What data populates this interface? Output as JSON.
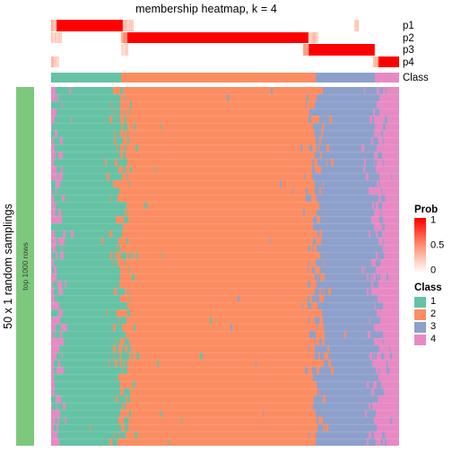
{
  "title": "membership heatmap, k = 4",
  "row_title": "50 x 1 random samplings",
  "row_group_label": "top 1000 rows",
  "annotation_rows": [
    {
      "label": "p1"
    },
    {
      "label": "p2"
    },
    {
      "label": "p3"
    },
    {
      "label": "p4"
    },
    {
      "label": "Class"
    }
  ],
  "legends": {
    "prob": {
      "title": "Prob",
      "ticks": [
        "1",
        "0.5",
        "0"
      ],
      "tick_values": [
        1,
        0.5,
        0
      ],
      "low_color": "#FFFFFF",
      "mid_color": "#FB9272",
      "high_color": "#FF0000"
    },
    "class": {
      "title": "Class",
      "items": [
        {
          "label": "1",
          "color": "#66C2A5"
        },
        {
          "label": "2",
          "color": "#FC8D62"
        },
        {
          "label": "3",
          "color": "#8DA0CB"
        },
        {
          "label": "4",
          "color": "#E78AC3"
        }
      ]
    }
  },
  "colors": {
    "class1": "#66C2A5",
    "class2": "#FC8D62",
    "class3": "#8DA0CB",
    "class4": "#E78AC3",
    "row_group_green": "#7DC87D",
    "background": "#FFFFFF"
  },
  "chart_data": {
    "type": "heatmap",
    "title": "membership heatmap, k = 4",
    "xlabel": "",
    "ylabel": "50 x 1 random samplings",
    "n_columns": 1000,
    "n_rows": 50,
    "legend_position": "right",
    "grid": false,
    "column_class_segments": [
      {
        "class": 4,
        "start": 0.0,
        "end": 0.013
      },
      {
        "class": 1,
        "start": 0.013,
        "end": 0.2
      },
      {
        "class": 2,
        "start": 0.2,
        "end": 0.76
      },
      {
        "class": 3,
        "start": 0.76,
        "end": 0.93
      },
      {
        "class": 4,
        "start": 0.93,
        "end": 1.0
      }
    ],
    "class_bar_segments": [
      {
        "class": 1,
        "start": 0.0,
        "end": 0.2
      },
      {
        "class": 2,
        "start": 0.2,
        "end": 0.76
      },
      {
        "class": 3,
        "start": 0.76,
        "end": 0.93
      },
      {
        "class": 4,
        "start": 0.93,
        "end": 1.0
      }
    ],
    "prob_rows": [
      {
        "name": "p1",
        "high_segments": [
          {
            "start": 0.016,
            "end": 0.206,
            "value": 1.0
          },
          {
            "start": 0.0,
            "end": 0.016,
            "value": 0.45
          },
          {
            "start": 0.206,
            "end": 0.236,
            "value": 0.3
          },
          {
            "start": 0.87,
            "end": 0.885,
            "value": 0.35
          }
        ]
      },
      {
        "name": "p2",
        "high_segments": [
          {
            "start": 0.218,
            "end": 0.74,
            "value": 1.0
          },
          {
            "start": 0.2,
            "end": 0.218,
            "value": 0.55
          },
          {
            "start": 0.74,
            "end": 0.768,
            "value": 0.3
          },
          {
            "start": 0.0,
            "end": 0.03,
            "value": 0.25
          }
        ]
      },
      {
        "name": "p3",
        "high_segments": [
          {
            "start": 0.74,
            "end": 0.93,
            "value": 1.0
          },
          {
            "start": 0.725,
            "end": 0.74,
            "value": 0.5
          },
          {
            "start": 0.2,
            "end": 0.222,
            "value": 0.25
          }
        ]
      },
      {
        "name": "p4",
        "high_segments": [
          {
            "start": 0.94,
            "end": 1.0,
            "value": 1.0
          },
          {
            "start": 0.925,
            "end": 0.94,
            "value": 0.45
          },
          {
            "start": 0.0,
            "end": 0.022,
            "value": 0.3
          }
        ]
      }
    ]
  }
}
